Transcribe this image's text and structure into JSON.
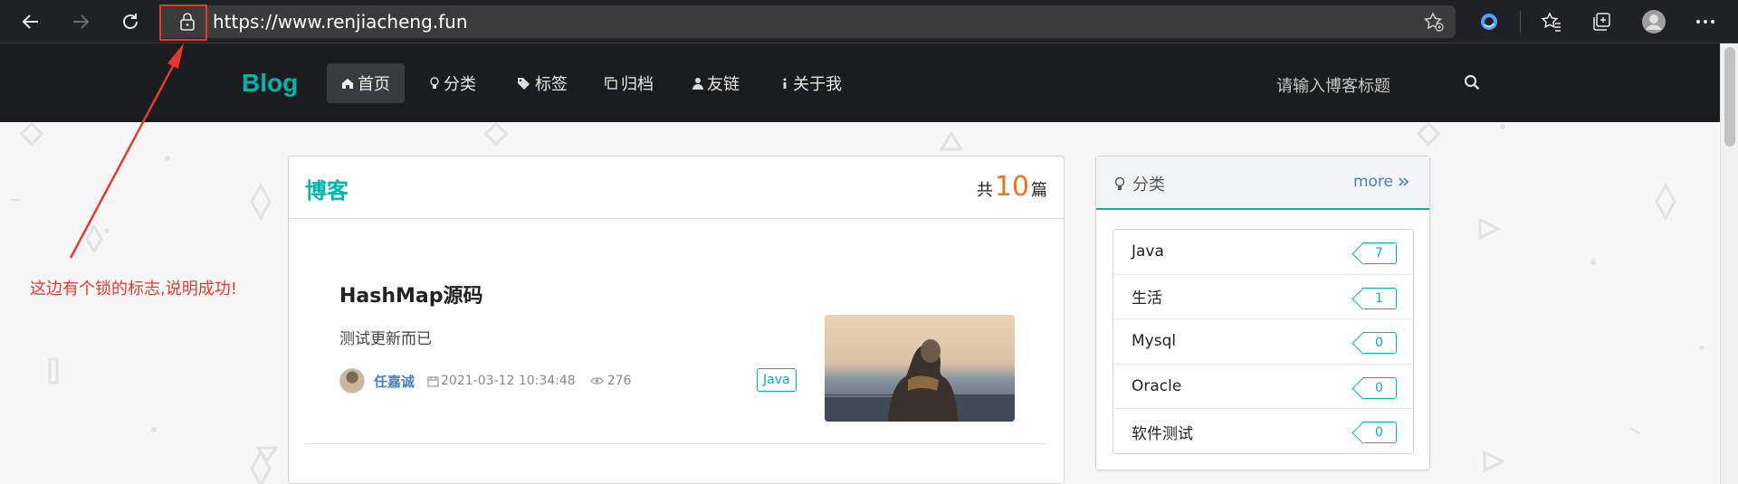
{
  "browser": {
    "url": "https://www.renjiacheng.fun"
  },
  "header": {
    "brand": "Blog",
    "menu": [
      {
        "label": "首页",
        "icon": "home-icon"
      },
      {
        "label": "分类",
        "icon": "lightbulb-icon"
      },
      {
        "label": "标签",
        "icon": "tags-icon"
      },
      {
        "label": "归档",
        "icon": "clone-icon"
      },
      {
        "label": "友链",
        "icon": "user-icon"
      },
      {
        "label": "关于我",
        "icon": "info-icon"
      }
    ],
    "search_placeholder": "请输入博客标题"
  },
  "blog": {
    "title": "博客",
    "count_prefix": "共",
    "count": "10",
    "count_suffix": "篇",
    "posts": [
      {
        "title": "HashMap源码",
        "description": "测试更新而已",
        "author": "任嘉诚",
        "date": "2021-03-12 10:34:48",
        "views": "276",
        "tag": "Java"
      }
    ]
  },
  "categories": {
    "title": "分类",
    "more": "more",
    "items": [
      {
        "name": "Java",
        "count": "7"
      },
      {
        "name": "生活",
        "count": "1"
      },
      {
        "name": "Mysql",
        "count": "0"
      },
      {
        "name": "Oracle",
        "count": "0"
      },
      {
        "name": "软件测试",
        "count": "0"
      }
    ]
  },
  "annotation": {
    "text": "这边有个锁的标志,说明成功!"
  },
  "colors": {
    "accent": "#00b5ad",
    "orange": "#f2711c",
    "link": "#4183c4",
    "annotation": "#e53935",
    "header_bg": "#1b1c1d"
  }
}
